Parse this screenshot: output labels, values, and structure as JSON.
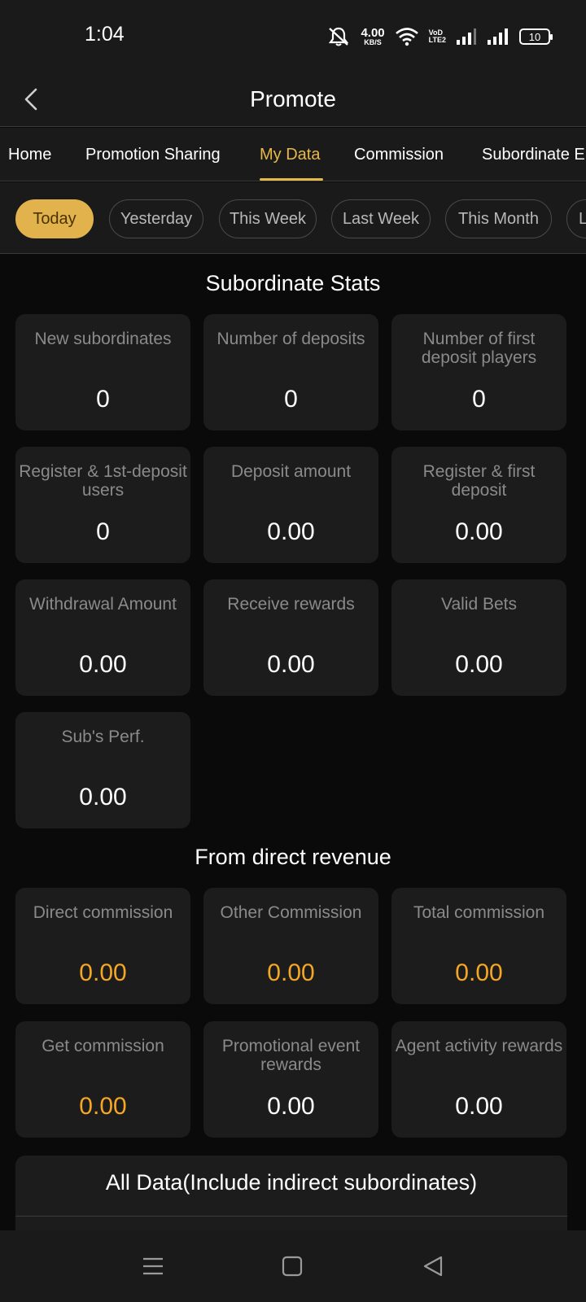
{
  "status": {
    "time": "1:04",
    "net_speed_value": "4.00",
    "net_speed_unit": "KB/S",
    "volte_top": "VoD",
    "volte_bottom": "LTE2",
    "battery": "10"
  },
  "header": {
    "title": "Promote"
  },
  "tabs": [
    {
      "label": "Home"
    },
    {
      "label": "Promotion Sharing"
    },
    {
      "label": "My Data"
    },
    {
      "label": "Commission"
    },
    {
      "label": "Subordinate E"
    }
  ],
  "filters": [
    {
      "label": "Today"
    },
    {
      "label": "Yesterday"
    },
    {
      "label": "This Week"
    },
    {
      "label": "Last Week"
    },
    {
      "label": "This Month"
    },
    {
      "label": "L"
    }
  ],
  "subordinate_stats": {
    "title": "Subordinate Stats",
    "cards": [
      {
        "label": "New subordinates",
        "value": "0"
      },
      {
        "label": "Number of deposits",
        "value": "0"
      },
      {
        "label": "Number of first deposit players",
        "value": "0"
      },
      {
        "label": "Register & 1st-deposit users",
        "value": "0"
      },
      {
        "label": "Deposit amount",
        "value": "0.00"
      },
      {
        "label": "Register & first deposit",
        "value": "0.00"
      },
      {
        "label": "Withdrawal Amount",
        "value": "0.00"
      },
      {
        "label": "Receive rewards",
        "value": "0.00"
      },
      {
        "label": "Valid Bets",
        "value": "0.00"
      },
      {
        "label": "Sub's Perf.",
        "value": "0.00"
      }
    ]
  },
  "direct_revenue": {
    "title": "From direct revenue",
    "cards": [
      {
        "label": "Direct commission",
        "value": "0.00"
      },
      {
        "label": "Other Commission",
        "value": "0.00"
      },
      {
        "label": "Total commission",
        "value": "0.00"
      },
      {
        "label": "Get commission",
        "value": "0.00"
      },
      {
        "label": "Promotional event rewards",
        "value": "0.00"
      },
      {
        "label": "Agent activity rewards",
        "value": "0.00"
      }
    ]
  },
  "all_data": {
    "title": "All Data(Include indirect subordinates)"
  },
  "colors": {
    "accent": "#e2b34d",
    "gold_value": "#f5a623",
    "card_bg": "#1c1c1c",
    "page_bg": "#0a0a0a"
  }
}
